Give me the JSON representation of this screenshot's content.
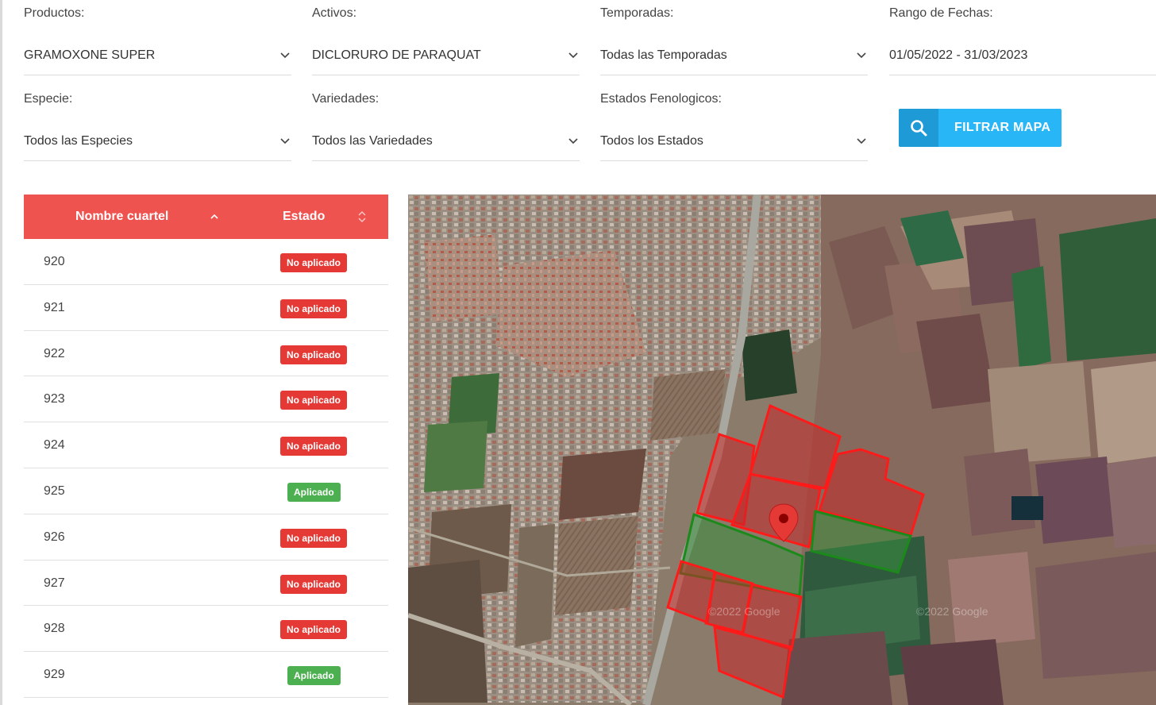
{
  "filters": {
    "productos": {
      "label": "Productos:",
      "value": "GRAMOXONE SUPER"
    },
    "activos": {
      "label": "Activos:",
      "value": "DICLORURO DE PARAQUAT"
    },
    "temporadas": {
      "label": "Temporadas:",
      "value": "Todas las Temporadas"
    },
    "rango": {
      "label": "Rango de Fechas:",
      "value": "01/05/2022 - 31/03/2023"
    },
    "especie": {
      "label": "Especie:",
      "value": "Todos las Especies"
    },
    "variedades": {
      "label": "Variedades:",
      "value": "Todos las Variedades"
    },
    "estados": {
      "label": "Estados Fenologicos:",
      "value": "Todos los Estados"
    }
  },
  "filter_button": {
    "label": "FILTRAR MAPA",
    "icon": "search-icon"
  },
  "table": {
    "columns": {
      "name": "Nombre cuartel",
      "estado": "Estado"
    },
    "rows": [
      {
        "name": "920",
        "estado": "No aplicado"
      },
      {
        "name": "921",
        "estado": "No aplicado"
      },
      {
        "name": "922",
        "estado": "No aplicado"
      },
      {
        "name": "923",
        "estado": "No aplicado"
      },
      {
        "name": "924",
        "estado": "No aplicado"
      },
      {
        "name": "925",
        "estado": "Aplicado"
      },
      {
        "name": "926",
        "estado": "No aplicado"
      },
      {
        "name": "927",
        "estado": "No aplicado"
      },
      {
        "name": "928",
        "estado": "No aplicado"
      },
      {
        "name": "929",
        "estado": "Aplicado"
      }
    ]
  },
  "map": {
    "watermark": "©2022 Google",
    "colors": {
      "applied": "#2e7d32",
      "not_applied": "#e53935",
      "pin": "#e53935"
    }
  },
  "colors": {
    "header_red": "#ef5350",
    "badge_red": "#e53935",
    "badge_green": "#4caf50",
    "button_blue": "#29b6f6"
  }
}
